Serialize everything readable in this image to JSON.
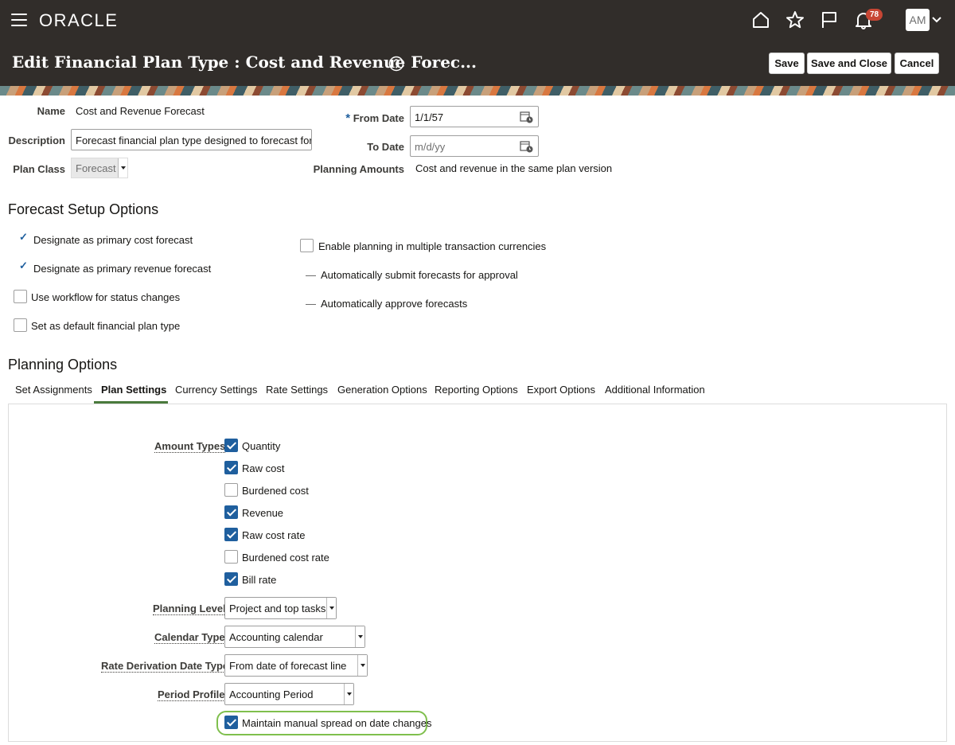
{
  "app": {
    "logo": "ORACLE",
    "notification_count": "78",
    "user_initials": "AM"
  },
  "title": {
    "text": "Edit Financial Plan Type : Cost and Revenue Forec...",
    "save": "Save",
    "save_close": "Save and Close",
    "cancel": "Cancel"
  },
  "form": {
    "name_label": "Name",
    "name_value": "Cost and Revenue Forecast",
    "description_label": "Description",
    "description_value": "Forecast financial plan type designed to forecast for ra",
    "plan_class_label": "Plan Class",
    "plan_class_value": "Forecast",
    "required_mark": "*",
    "from_date_label": "From Date",
    "from_date_value": "1/1/57",
    "to_date_label": "To Date",
    "to_date_placeholder": "m/d/yy",
    "planning_amounts_label": "Planning Amounts",
    "planning_amounts_value": "Cost and revenue in the same plan version"
  },
  "forecast_setup": {
    "heading": "Forecast Setup Options",
    "tick": "✓",
    "primary_cost": "Designate as primary cost forecast",
    "primary_revenue": "Designate as primary revenue forecast",
    "workflow": "Use workflow for status changes",
    "default_type": "Set as default financial plan type",
    "multi_currency": "Enable planning in multiple transaction currencies",
    "auto_submit": "Automatically submit forecasts for approval",
    "auto_approve": "Automatically approve forecasts"
  },
  "planning": {
    "heading": "Planning Options",
    "tabs": [
      "Set Assignments",
      "Plan Settings",
      "Currency Settings",
      "Rate Settings",
      "Generation Options",
      "Reporting Options",
      "Export Options",
      "Additional Information"
    ],
    "active_tab": "Plan Settings",
    "amount_types_label": "Amount Types",
    "amount_types": [
      {
        "label": "Quantity",
        "checked": true
      },
      {
        "label": "Raw cost",
        "checked": true
      },
      {
        "label": "Burdened cost",
        "checked": false
      },
      {
        "label": "Revenue",
        "checked": true
      },
      {
        "label": "Raw cost rate",
        "checked": true
      },
      {
        "label": "Burdened cost rate",
        "checked": false
      },
      {
        "label": "Bill rate",
        "checked": true
      }
    ],
    "planning_level_label": "Planning Level",
    "planning_level_value": "Project and top tasks",
    "calendar_type_label": "Calendar Type",
    "calendar_type_value": "Accounting calendar",
    "rate_derivation_label": "Rate Derivation Date Type",
    "rate_derivation_value": "From date of forecast line",
    "period_profile_label": "Period Profile",
    "period_profile_value": "Accounting Period",
    "manual_spread_label": "Maintain manual spread on date changes"
  }
}
